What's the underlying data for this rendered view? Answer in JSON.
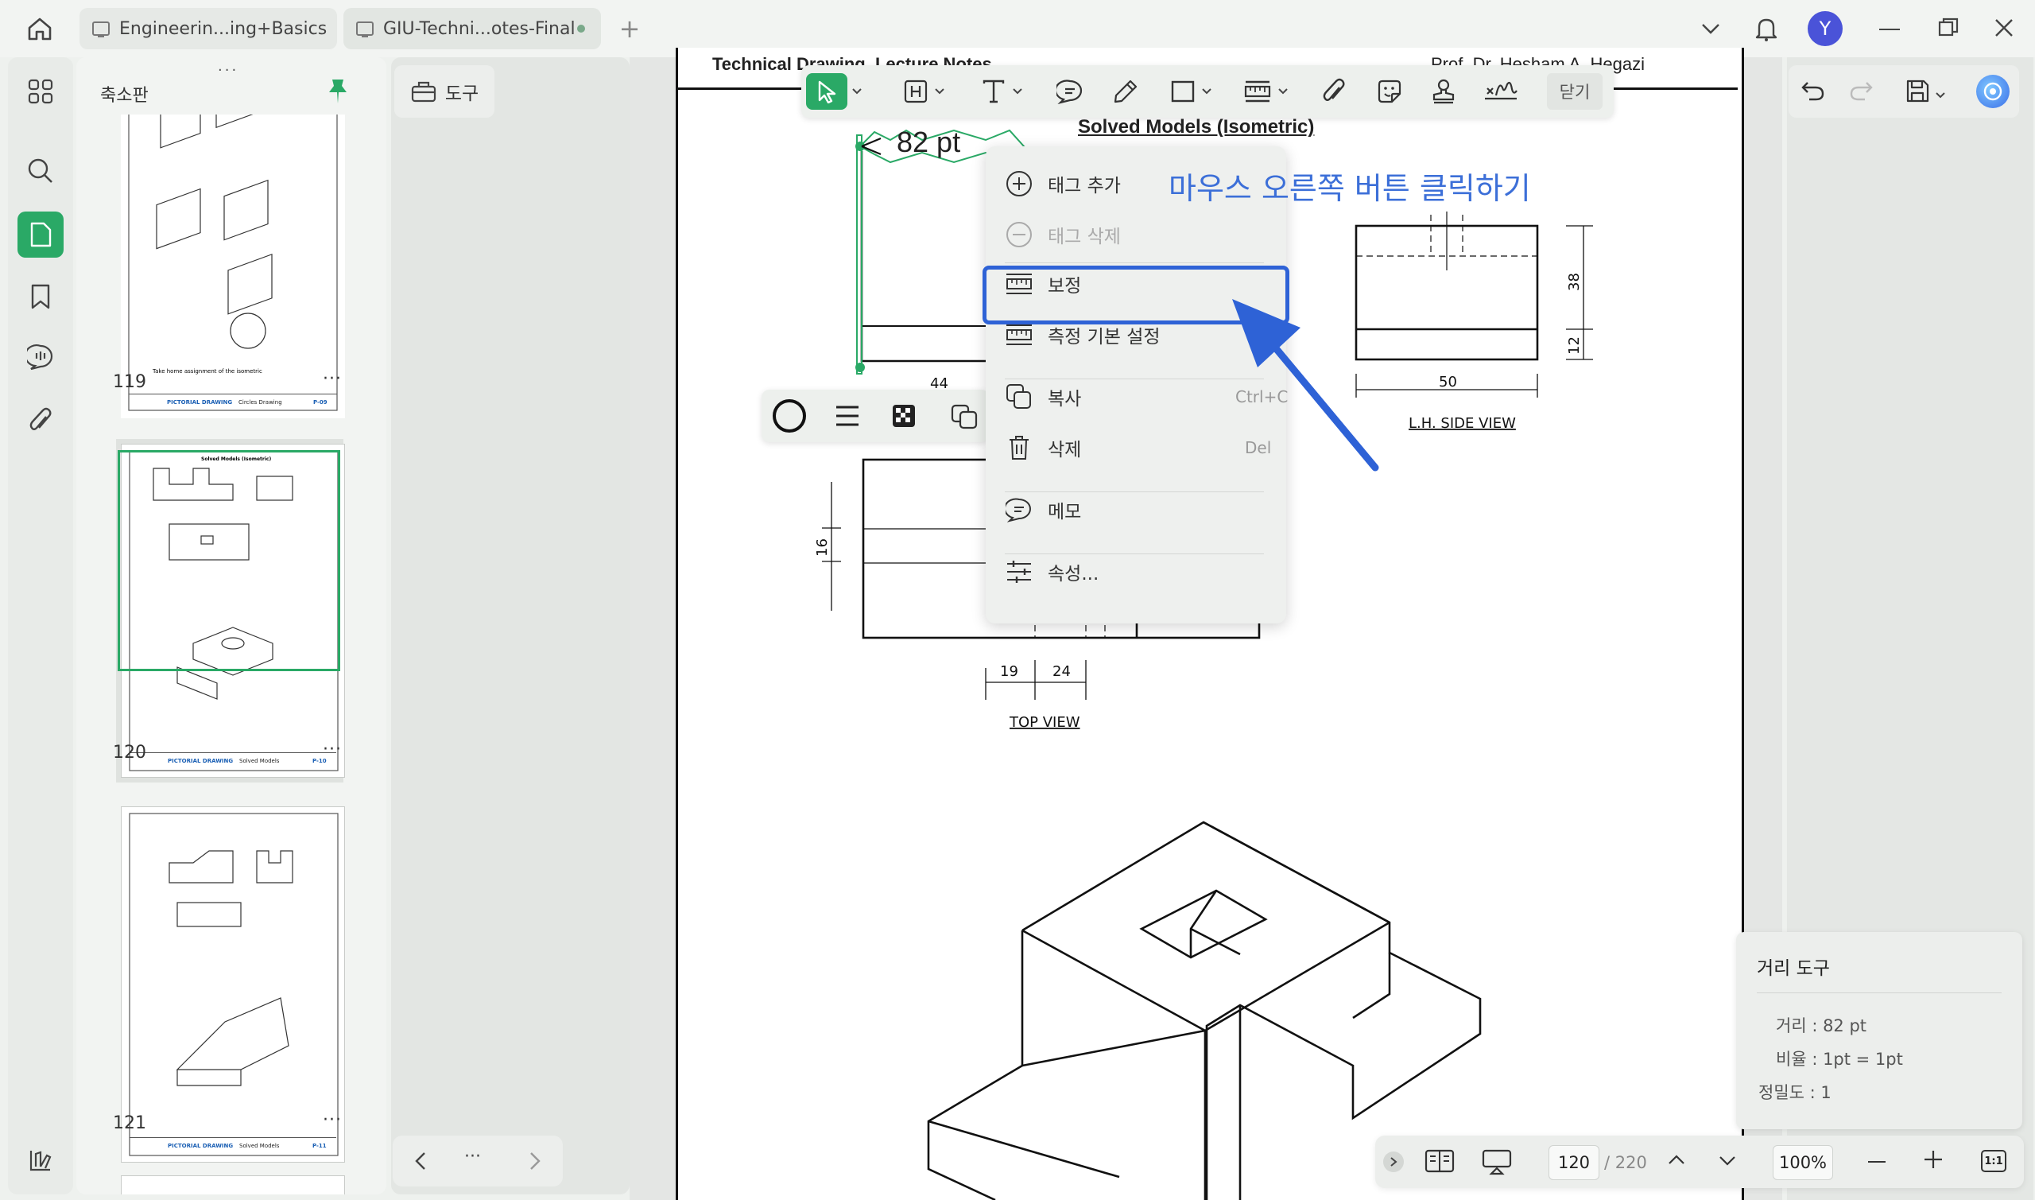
{
  "tabs": [
    {
      "label": "Engineerin...ing+Basics",
      "active": false
    },
    {
      "label": "GIU-Techni...otes-Final",
      "active": true,
      "modified": true
    }
  ],
  "user": {
    "avatar_initial": "Y",
    "avatar_color": "#4a53d8"
  },
  "accent_color": "#2aa966",
  "left_rail": {
    "items": [
      "grid-icon",
      "search-icon",
      "page-icon",
      "bookmark-icon",
      "comment-icon",
      "attachment-icon"
    ],
    "bottom": "library-icon"
  },
  "thumbnail_panel": {
    "title": "축소판",
    "pages": [
      {
        "number": "119",
        "footer_left": "PICTORIAL DRAWING",
        "footer_mid": "Circles Drawing",
        "footer_right": "P-09"
      },
      {
        "number": "120",
        "footer_left": "PICTORIAL DRAWING",
        "footer_mid": "Solved Models",
        "footer_right": "P-10",
        "selected": true
      },
      {
        "number": "121",
        "footer_left": "PICTORIAL DRAWING",
        "footer_mid": "Solved Models",
        "footer_right": "P-11"
      }
    ],
    "more_label": "···"
  },
  "tools_button": {
    "label": "도구"
  },
  "toolbar": {
    "close_label": "닫기"
  },
  "document": {
    "header_left": "Technical Drawing, Lecture Notes",
    "header_right": "Prof. Dr. Hesham A. Hegazi",
    "title": "Solved Models (Isometric)",
    "measure_label": "82 pt",
    "dims": {
      "d44": "44",
      "d16": "16",
      "d19": "19",
      "d24": "24",
      "d38": "38",
      "d12": "12",
      "d50": "50"
    },
    "top_view_label": "TOP VIEW",
    "side_view_label": "L.H. SIDE VIEW"
  },
  "annotation": {
    "text": "마우스 오른쪽 버튼 클릭하기",
    "color": "#3c6fd8"
  },
  "context_menu": {
    "add_tag": "태그 추가",
    "remove_tag": "태그 삭제",
    "calibrate": "보정",
    "measure_settings": "측정 기본 설정",
    "copy": "복사",
    "copy_shortcut": "Ctrl+C",
    "delete": "삭제",
    "delete_shortcut": "Del",
    "memo": "메모",
    "properties": "속성..."
  },
  "distance_tool": {
    "title": "거리 도구",
    "distance": "거리 : 82 pt",
    "ratio": "비율 : 1pt = 1pt",
    "precision": "정밀도 : 1"
  },
  "bottom_bar": {
    "page_current": "120",
    "page_total": "/ 220",
    "zoom": "100%",
    "ratio_button": "1:1"
  }
}
